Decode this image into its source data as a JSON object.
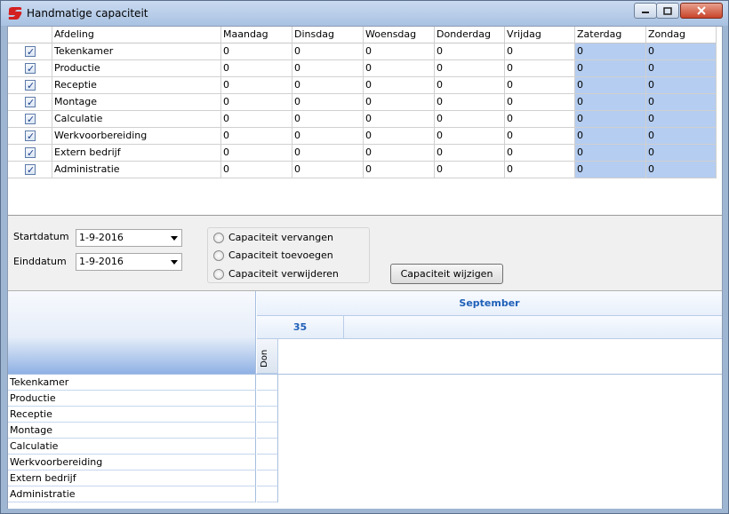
{
  "window": {
    "title": "Handmatige capaciteit"
  },
  "grid": {
    "columns": [
      "Afdeling",
      "Maandag",
      "Dinsdag",
      "Woensdag",
      "Donderdag",
      "Vrijdag",
      "Zaterdag",
      "Zondag"
    ],
    "rows": [
      {
        "checked": true,
        "afdeling": "Tekenkamer",
        "values": [
          "0",
          "0",
          "0",
          "0",
          "0",
          "0",
          "0"
        ]
      },
      {
        "checked": true,
        "afdeling": "Productie",
        "values": [
          "0",
          "0",
          "0",
          "0",
          "0",
          "0",
          "0"
        ]
      },
      {
        "checked": true,
        "afdeling": "Receptie",
        "values": [
          "0",
          "0",
          "0",
          "0",
          "0",
          "0",
          "0"
        ]
      },
      {
        "checked": true,
        "afdeling": "Montage",
        "values": [
          "0",
          "0",
          "0",
          "0",
          "0",
          "0",
          "0"
        ]
      },
      {
        "checked": true,
        "afdeling": "Calculatie",
        "values": [
          "0",
          "0",
          "0",
          "0",
          "0",
          "0",
          "0"
        ]
      },
      {
        "checked": true,
        "afdeling": "Werkvoorbereiding",
        "values": [
          "0",
          "0",
          "0",
          "0",
          "0",
          "0",
          "0"
        ]
      },
      {
        "checked": true,
        "afdeling": "Extern bedrijf",
        "values": [
          "0",
          "0",
          "0",
          "0",
          "0",
          "0",
          "0"
        ]
      },
      {
        "checked": true,
        "afdeling": "Administratie",
        "values": [
          "0",
          "0",
          "0",
          "0",
          "0",
          "0",
          "0"
        ]
      }
    ]
  },
  "form": {
    "startdatum_label": "Startdatum",
    "startdatum_value": "1-9-2016",
    "einddatum_label": "Einddatum",
    "einddatum_value": "1-9-2016",
    "radio_options": [
      "Capaciteit vervangen",
      "Capaciteit toevoegen",
      "Capaciteit verwijderen"
    ],
    "apply_button": "Capaciteit wijzigen"
  },
  "planner": {
    "month": "September",
    "week": "35",
    "day": "Don",
    "rows": [
      "Tekenkamer",
      "Productie",
      "Receptie",
      "Montage",
      "Calculatie",
      "Werkvoorbereiding",
      "Extern bedrijf",
      "Administratie"
    ]
  },
  "colors": {
    "weekend": "#b5cdf0",
    "accent": "#1f5fb8"
  }
}
